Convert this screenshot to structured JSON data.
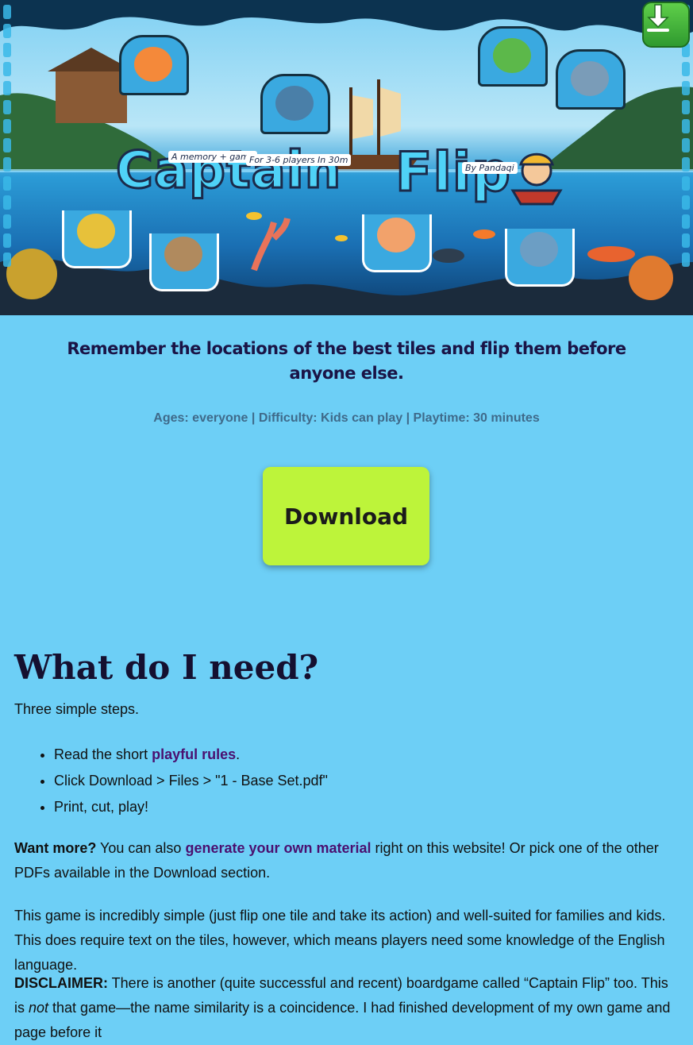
{
  "hero": {
    "title_word_1": "Captain",
    "title_word_2": "Flip",
    "tag_game": "A memory + game",
    "tag_players": "For 3-6 players",
    "tag_time": "In 30m",
    "tag_by": "By Pandaqi",
    "corner_icon": "download-arrow-icon"
  },
  "subtitle": "Remember the locations of the best tiles and flip them before anyone else.",
  "meta": "Ages: everyone | Difficulty: Kids can play | Playtime: 30 minutes",
  "download_label": "Download",
  "section": {
    "heading": "What do I need?",
    "intro": "Three simple steps.",
    "steps": [
      {
        "before": "Read the short ",
        "link": "playful rules",
        "after": "."
      },
      {
        "text": "Click Download > Files > \"1 - Base Set.pdf\""
      },
      {
        "text": "Print, cut, play!"
      }
    ],
    "more_bold": "Want more?",
    "more_before": " You can also ",
    "more_link": "generate your own material",
    "more_after": " right on this website! Or pick one of the other PDFs available in the Download section.",
    "simple_text": "This game is incredibly simple (just flip one tile and take its action) and well-suited for families and kids. This does require text on the tiles, however, which means players need some knowledge of the English language.",
    "disclaimer_bold": "DISCLAIMER:",
    "disclaimer_before": " There is another (quite successful and recent) boardgame called “Captain Flip” too. This is ",
    "disclaimer_em": "not",
    "disclaimer_after": " that game—the name similarity is a coincidence. I had finished development of my own game and page before it"
  },
  "colors": {
    "background": "#6dcff6",
    "download_button": "#bdf43a",
    "link": "#4a1070",
    "heading": "#151030"
  }
}
